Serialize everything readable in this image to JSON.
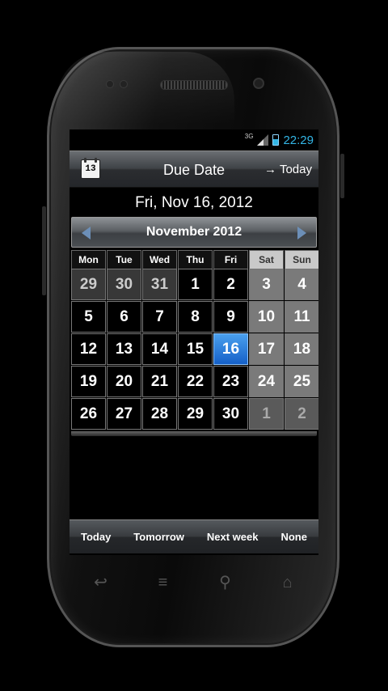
{
  "status": {
    "network": "3G",
    "time": "22:29"
  },
  "header": {
    "title": "Due Date",
    "today_label": "Today",
    "calendar_icon_number": "13"
  },
  "selected_date_text": "Fri, Nov 16, 2012",
  "calendar": {
    "month_label": "November 2012",
    "weekdays": [
      "Mon",
      "Tue",
      "Wed",
      "Thu",
      "Fri",
      "Sat",
      "Sun"
    ],
    "weeks": [
      [
        "29",
        "30",
        "31",
        "1",
        "2",
        "3",
        "4"
      ],
      [
        "5",
        "6",
        "7",
        "8",
        "9",
        "10",
        "11"
      ],
      [
        "12",
        "13",
        "14",
        "15",
        "16",
        "17",
        "18"
      ],
      [
        "19",
        "20",
        "21",
        "22",
        "23",
        "24",
        "25"
      ],
      [
        "26",
        "27",
        "28",
        "29",
        "30",
        "1",
        "2"
      ]
    ],
    "selected_day": "16"
  },
  "quick": {
    "today": "Today",
    "tomorrow": "Tomorrow",
    "next_week": "Next week",
    "none": "None"
  },
  "colors": {
    "accent": "#33b5e5",
    "selected": "#1f6fd6"
  },
  "icons": {
    "back": "back-icon",
    "menu": "menu-icon",
    "search": "search-icon",
    "home": "home-icon"
  }
}
